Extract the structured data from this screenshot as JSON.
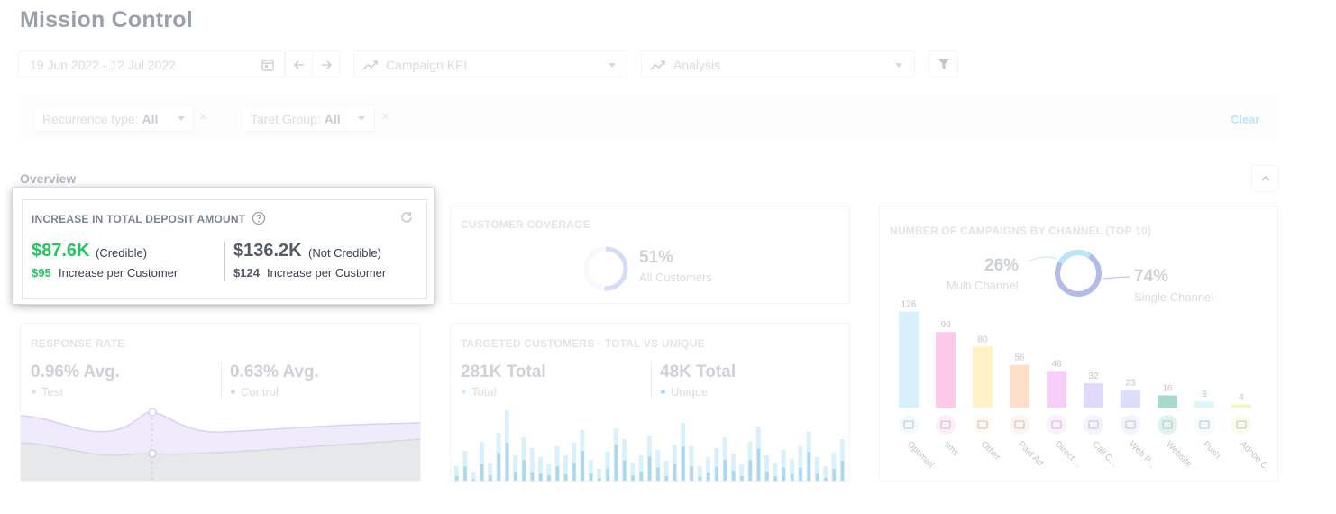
{
  "page": {
    "title": "Mission Control"
  },
  "toolbar": {
    "date_range": "19 Jun 2022 - 12 Jul 2022",
    "kpi_select": "Campaign KPI",
    "analysis_select": "Analysis"
  },
  "filters": {
    "recurrence_label": "Recurrence type:",
    "recurrence_value": "All",
    "target_label": "Taret Group:",
    "target_value": "All",
    "remove_glyph": "×",
    "clear_label": "Clear"
  },
  "overview": {
    "label": "Overview"
  },
  "deposit_card": {
    "title": "INCREASE IN TOTAL DEPOSIT AMOUNT",
    "credible_value": "$87.6K",
    "credible_label": "(Credible)",
    "credible_per_value": "$95",
    "credible_per_label": "Increase per Customer",
    "not_credible_value": "$136.2K",
    "not_credible_label": "(Not Credible)",
    "not_credible_per_value": "$124",
    "not_credible_per_label": "Increase per Customer"
  },
  "coverage_card": {
    "title": "CUSTOMER COVERAGE",
    "percent": "51%",
    "percent_value": 0.51,
    "label": "All Customers"
  },
  "response_card": {
    "title": "RESPONSE RATE",
    "test_value": "0.96% Avg.",
    "test_label": "Test",
    "control_value": "0.63% Avg.",
    "control_label": "Control"
  },
  "targeted_card": {
    "title": "TARGETED CUSTOMERS - TOTAL VS UNIQUE",
    "total_value": "281K Total",
    "total_label": "Total",
    "unique_value": "48K Total",
    "unique_label": "Unique"
  },
  "channel_card": {
    "title": "NUMBER OF CAMPAIGNS BY CHANNEL (TOP 10)",
    "multi_percent": "26%",
    "multi_label": "Multi Channel",
    "single_percent": "74%",
    "single_label": "Single Channel",
    "split_value": 0.26
  },
  "colors": {
    "accent_green": "#21c65e",
    "coverage_ring": "#b9c7f5",
    "bar_light": "#a7dcf5",
    "bar_dark": "#3aa0d8"
  },
  "chart_data": {
    "type": "bar",
    "title": "NUMBER OF CAMPAIGNS BY CHANNEL (TOP 10)",
    "categories": [
      "Optimail",
      "sms",
      "Other",
      "Paid Ad",
      "Direct ...",
      "Call C...",
      "Web P...",
      "Website",
      "Push",
      "Adobe C..."
    ],
    "values": [
      126,
      99,
      80,
      56,
      48,
      32,
      23,
      16,
      8,
      4
    ],
    "bar_colors": [
      "#9fdcf7",
      "#f77fcf",
      "#ffe07a",
      "#ffb27a",
      "#e88af0",
      "#b7a4f0",
      "#a8b4f2",
      "#2aa885",
      "#a6eef0",
      "#d0ee6a"
    ],
    "icons": [
      "mail-icon",
      "chat-icon",
      "bell-icon",
      "ad-icon",
      "eraser-icon",
      "headset-icon",
      "browser-icon",
      "chat-bubble-icon",
      "mobile-icon",
      "mail-icon"
    ],
    "xlabel": "",
    "ylabel": "",
    "ylim": [
      0,
      130
    ]
  }
}
